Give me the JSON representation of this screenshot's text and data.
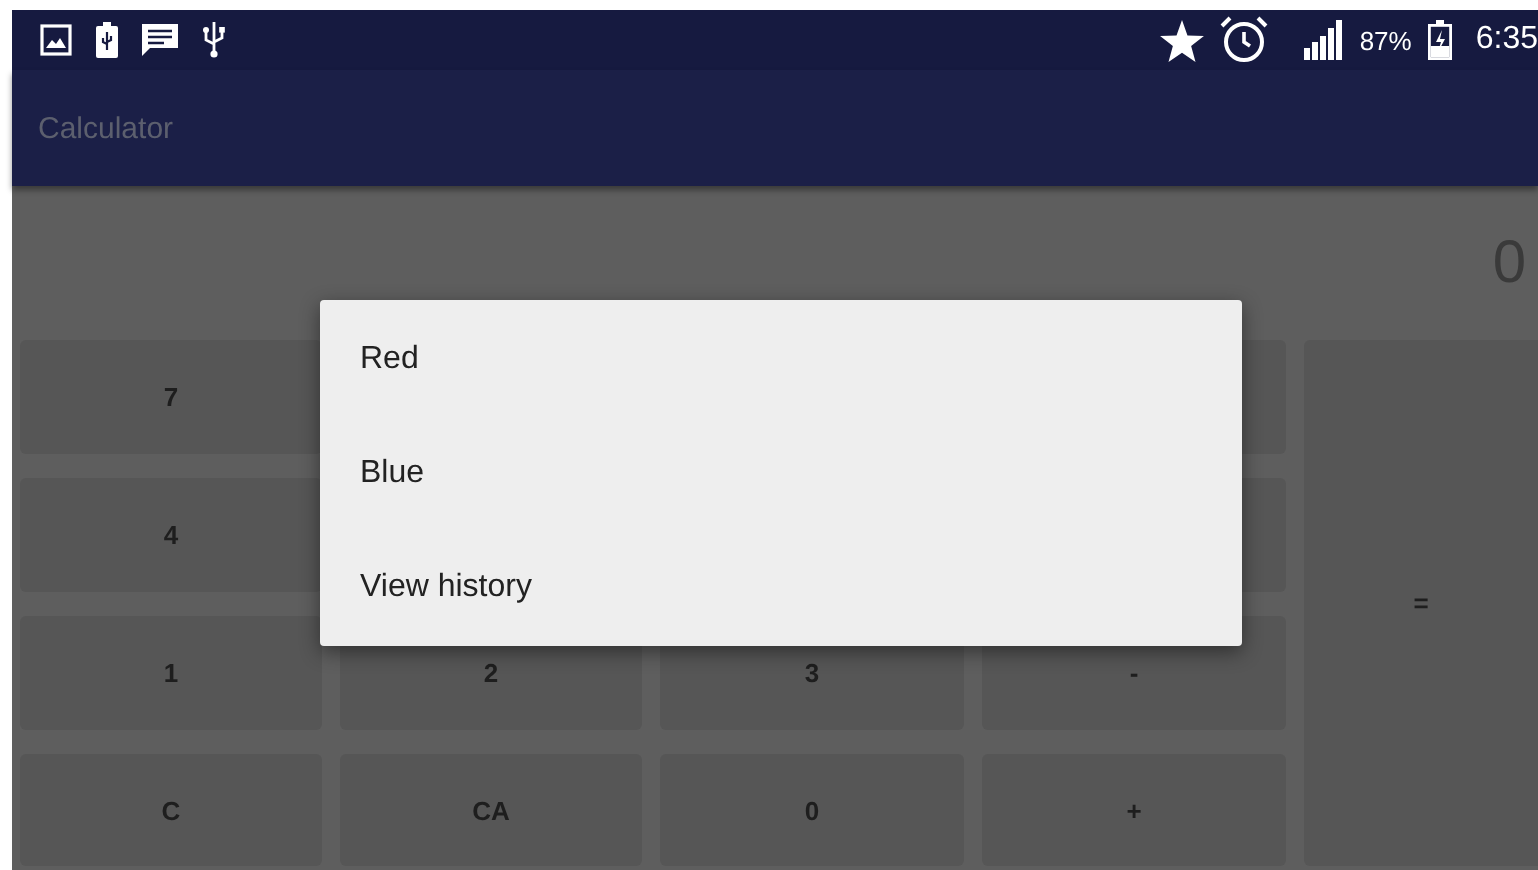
{
  "status_bar": {
    "battery": "87%",
    "time": "6:35"
  },
  "app_bar": {
    "title": "Calculator"
  },
  "display": {
    "value": "0"
  },
  "keypad": {
    "keys": [
      {
        "kind": "key",
        "label": "7"
      },
      {
        "kind": "covered"
      },
      {
        "kind": "tall",
        "label": "="
      },
      {
        "kind": "key",
        "label": "4"
      },
      {
        "kind": "covered"
      },
      {
        "kind": "key",
        "label": "1"
      },
      {
        "kind": "key",
        "label": "2"
      },
      {
        "kind": "key",
        "label": "3"
      },
      {
        "kind": "key",
        "label": "-"
      },
      {
        "kind": "key",
        "label": "C"
      },
      {
        "kind": "key",
        "label": "CA"
      },
      {
        "kind": "key",
        "label": "0"
      },
      {
        "kind": "key",
        "label": "+"
      }
    ]
  },
  "menu": {
    "items": [
      {
        "label": "Red"
      },
      {
        "label": "Blue"
      },
      {
        "label": "View history"
      }
    ]
  }
}
